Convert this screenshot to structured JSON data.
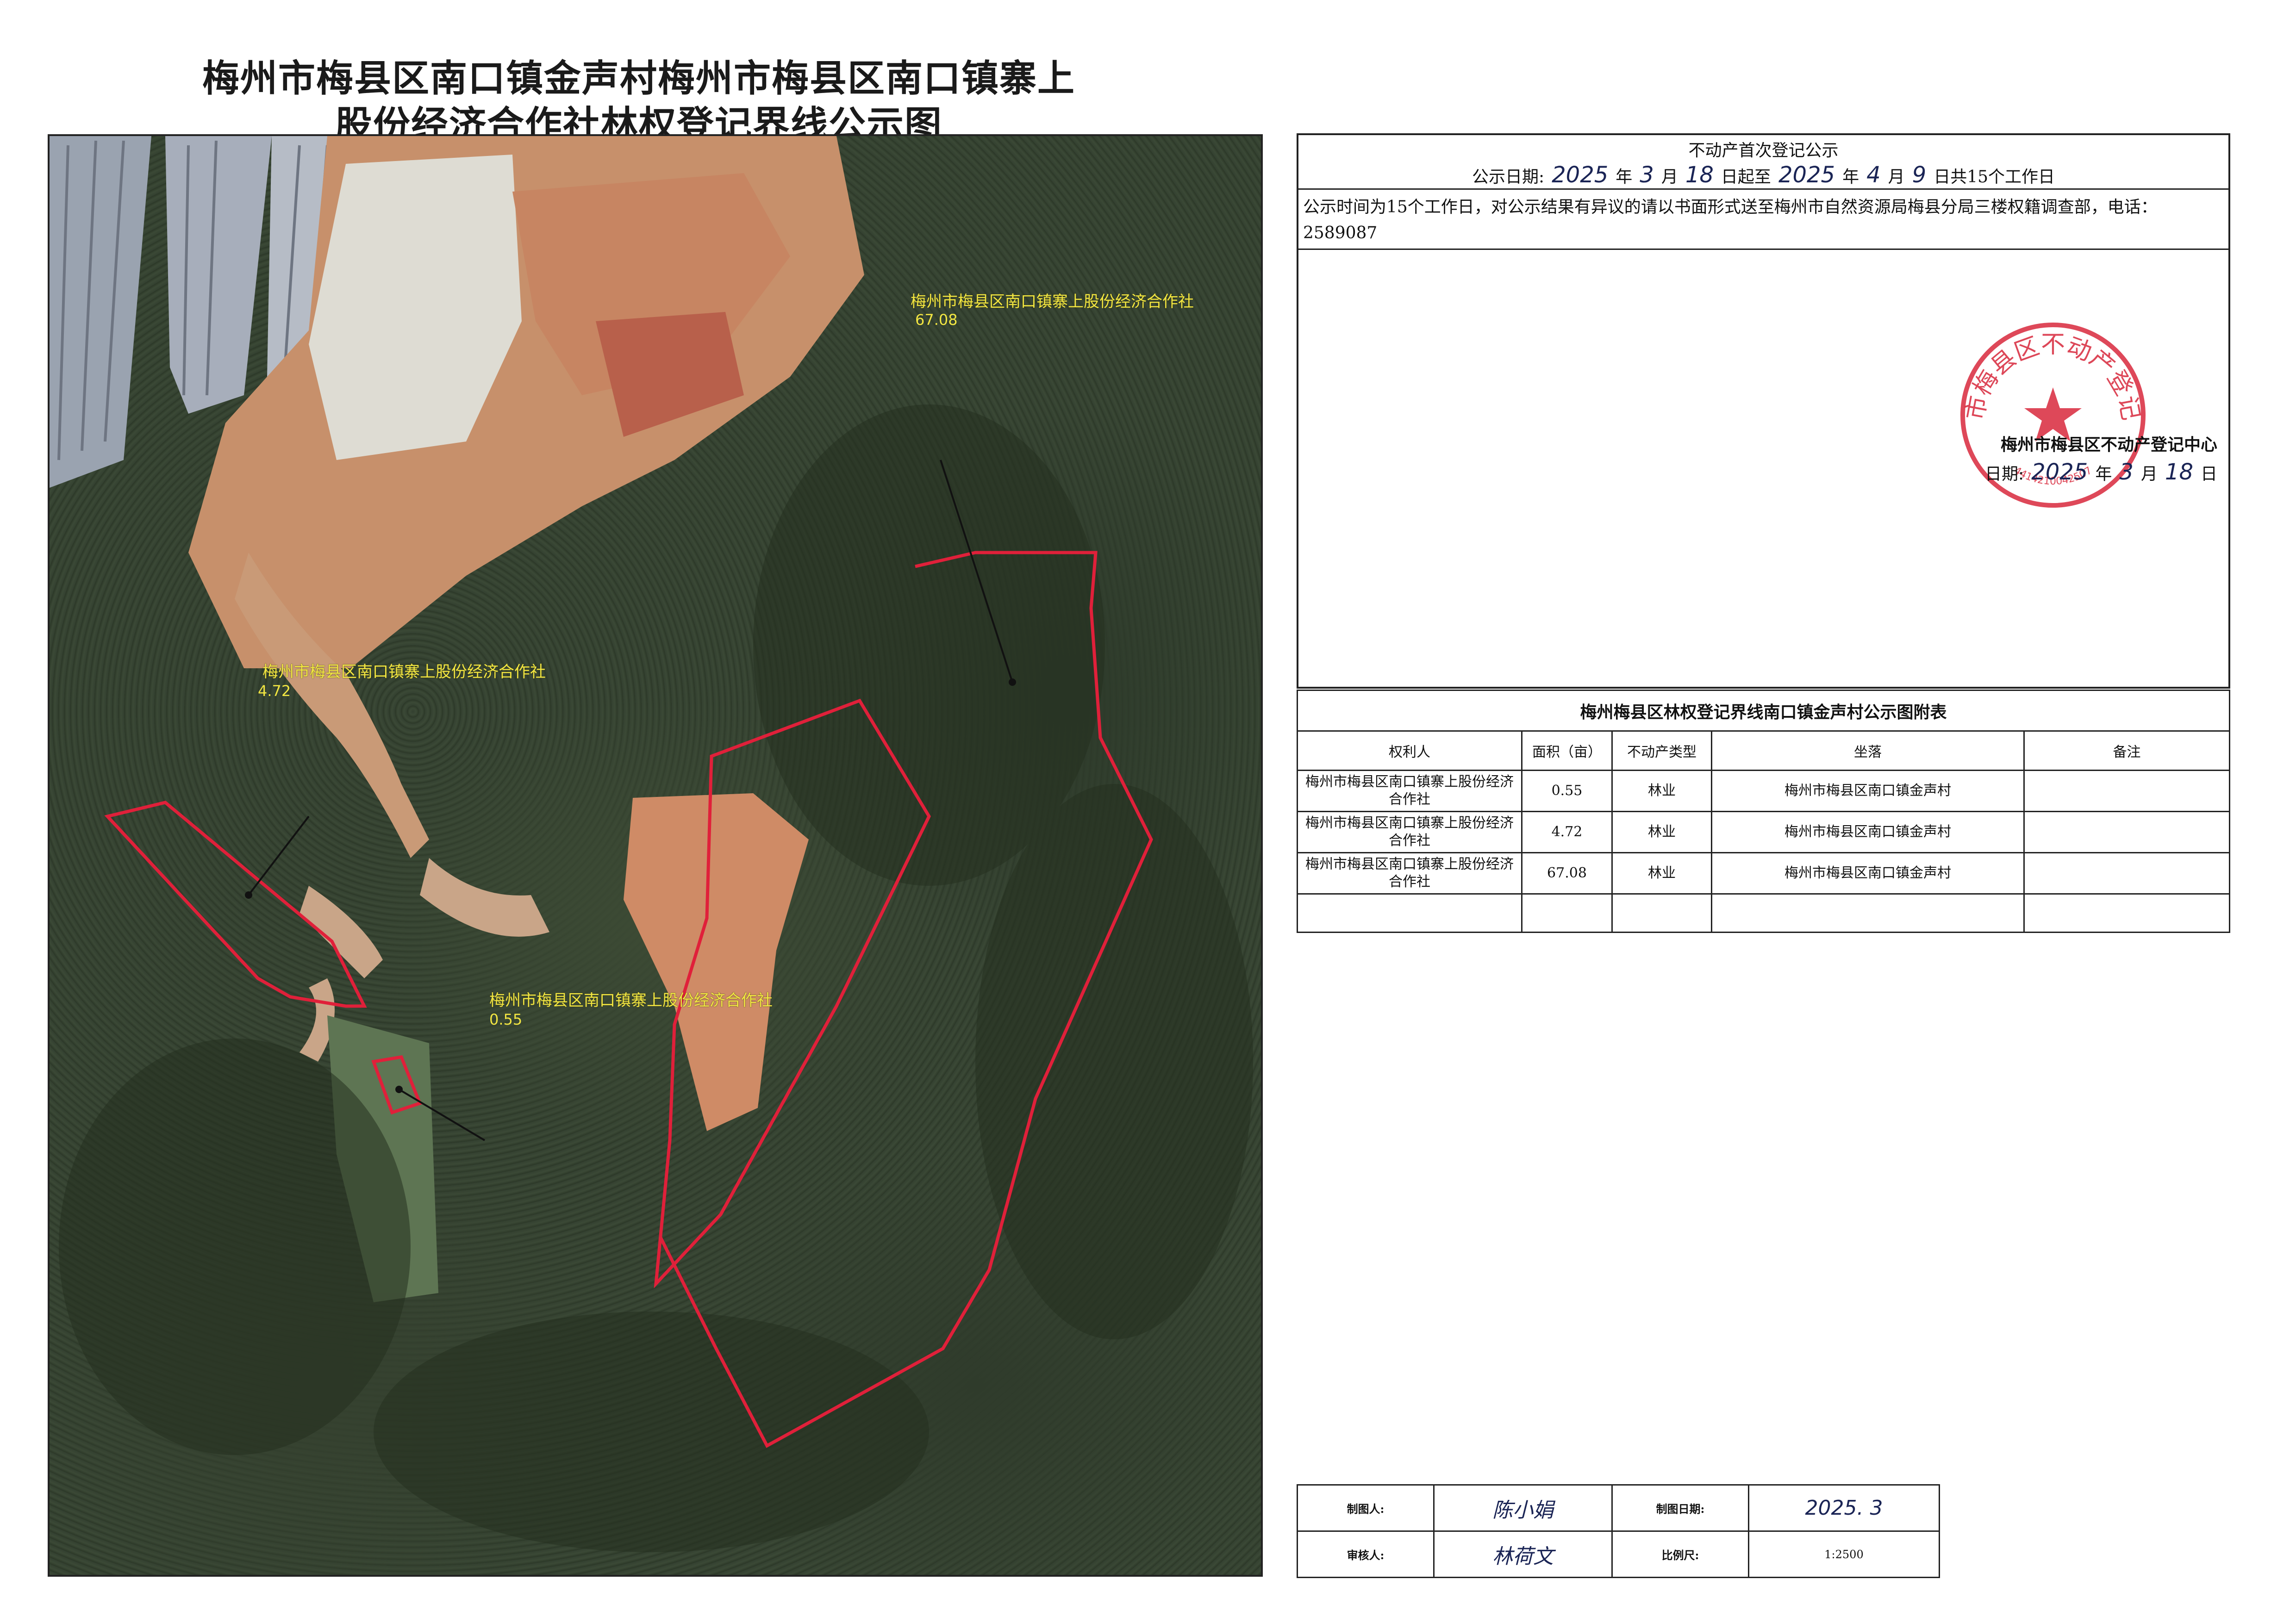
{
  "title": {
    "line1": "梅州市梅县区南口镇金声村梅州市梅县区南口镇寨上",
    "line2": "股份经济合作社林权登记界线公示图"
  },
  "map": {
    "parcels": [
      {
        "owner": "梅州市梅县区南口镇寨上股份经济合作社",
        "area": "67.08"
      },
      {
        "owner": "梅州市梅县区南口镇寨上股份经济合作社",
        "area": "4.72"
      },
      {
        "owner": "梅州市梅县区南口镇寨上股份经济合作社",
        "area": "0.55"
      }
    ],
    "boundary_color": "#e0203a",
    "label_color": "#f2e642"
  },
  "notice": {
    "title": "不动产首次登记公示",
    "date_prefix": "公示日期:",
    "start_year": "2025",
    "year_label": "年",
    "start_month": "3",
    "month_label": "月",
    "start_day": "18",
    "from_label": "日起至",
    "end_year": "2025",
    "end_month": "4",
    "end_day": "9",
    "end_label": "日共15个工作日",
    "body": "公示时间为15个工作日，对公示结果有异议的请以书面形式送至梅州市自然资源局梅县分局三楼权籍调查部，电话：2589087",
    "authority": "梅州市梅县区不动产登记中心",
    "date_label": "日期:",
    "sign_year": "2025",
    "sign_month": "3",
    "sign_day": "18",
    "day_label": "日",
    "stamp_text": "梅州市梅县区不动产登记中心",
    "stamp_number": "4414210042507",
    "stamp_color": "#d8283c"
  },
  "attachment": {
    "title": "梅州梅县区林权登记界线南口镇金声村公示图附表",
    "headers": [
      "权利人",
      "面积（亩）",
      "不动产类型",
      "坐落",
      "备注"
    ],
    "rows": [
      {
        "owner": "梅州市梅县区南口镇寨上股份经济合作社",
        "area": "0.55",
        "type": "林业",
        "location": "梅州市梅县区南口镇金声村",
        "note": ""
      },
      {
        "owner": "梅州市梅县区南口镇寨上股份经济合作社",
        "area": "4.72",
        "type": "林业",
        "location": "梅州市梅县区南口镇金声村",
        "note": ""
      },
      {
        "owner": "梅州市梅县区南口镇寨上股份经济合作社",
        "area": "67.08",
        "type": "林业",
        "location": "梅州市梅县区南口镇金声村",
        "note": ""
      }
    ]
  },
  "signoff": {
    "maker_label": "制图人:",
    "maker": "陈小娟",
    "date_label": "制图日期:",
    "date": "2025. 3",
    "reviewer_label": "审核人:",
    "reviewer": "林荷文",
    "scale_label": "比例尺:",
    "scale": "1:2500"
  }
}
